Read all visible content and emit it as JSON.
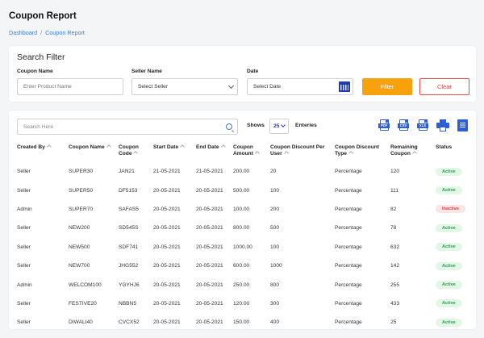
{
  "page": {
    "title": "Coupon Report",
    "breadcrumb": [
      "Dashboard",
      "Coupon Report"
    ]
  },
  "filter": {
    "title": "Search Filter",
    "coupon_name_label": "Coupon Name",
    "coupon_name_placeholder": "Enter Product Name",
    "seller_name_label": "Seller Name",
    "seller_select_value": "Select Seller",
    "date_label": "Date",
    "date_value": "Select Date",
    "filter_button": "Filter",
    "clear_button": "Clear"
  },
  "toolbar": {
    "search_placeholder": "Search Here",
    "shows_label": "Shows",
    "page_size": "25",
    "entries_label": "Enteries",
    "exports": [
      "PDF",
      "CSV",
      "XLS"
    ]
  },
  "colors": {
    "accent": "#f7a10d",
    "primary_blue": "#2c5fd6",
    "danger": "#e04a4a",
    "active_text": "#2ea04f",
    "inactive_text": "#d9413f"
  },
  "table": {
    "headers": [
      "Created By",
      "Coupon Name",
      "Coupon Code",
      "Start Date",
      "End Date",
      "Coupon Amount",
      "Coupon Discount Per User",
      "Coupon Discount Type",
      "Remaining Coupon",
      "Status"
    ],
    "rows": [
      [
        "Seller",
        "SUPER30",
        "JAN21",
        "21-05-2021",
        "21-05-2021",
        "200.00",
        "20",
        "Percentage",
        "120",
        "Active"
      ],
      [
        "Seller",
        "SUPER50",
        "DF5153",
        "20-05-2021",
        "20-05-2021",
        "500.00",
        "100",
        "Percentage",
        "111",
        "Active"
      ],
      [
        "Admin",
        "SUPER70",
        "SAFAS5",
        "20-05-2021",
        "20-05-2021",
        "100.00",
        "200",
        "Percentage",
        "82",
        "Inactive"
      ],
      [
        "Seller",
        "NEW200",
        "SD545S",
        "20-05-2021",
        "20-05-2021",
        "800.00",
        "500",
        "Percentage",
        "78",
        "Active"
      ],
      [
        "Seller",
        "NEW500",
        "SDF741",
        "20-05-2021",
        "20-05-2021",
        "1000.00",
        "100",
        "Percentage",
        "632",
        "Active"
      ],
      [
        "Seller",
        "NEW700",
        "JHG552",
        "20-05-2021",
        "20-05-2021",
        "600.00",
        "1000",
        "Percentage",
        "142",
        "Active"
      ],
      [
        "Admin",
        "WELCOM100",
        "YGYHJ6",
        "20-05-2021",
        "20-05-2021",
        "250.00",
        "800",
        "Percentage",
        "255",
        "Active"
      ],
      [
        "Seller",
        "FESTIVE20",
        "NBBN5",
        "20-05-2021",
        "20-05-2021",
        "120.00",
        "300",
        "Percentage",
        "433",
        "Active"
      ],
      [
        "Seller",
        "DIWALI40",
        "CVCX52",
        "20-05-2021",
        "20-05-2021",
        "150.00",
        "400",
        "Percentage",
        "25",
        "Active"
      ]
    ]
  }
}
